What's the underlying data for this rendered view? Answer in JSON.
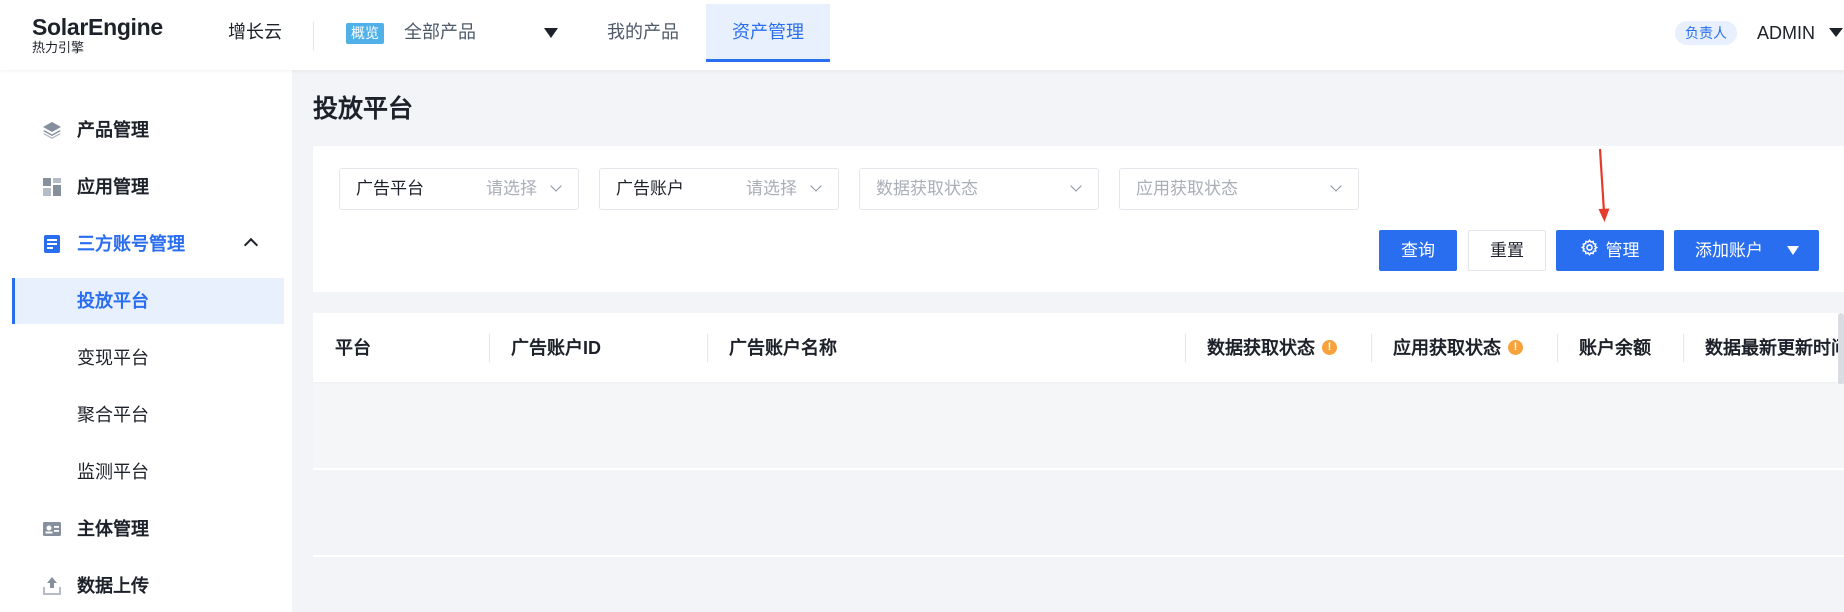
{
  "header": {
    "logo_main": "SolarEngine",
    "logo_sub": "热力引擎",
    "nav_growth": "增长云",
    "overview_badge": "概览",
    "all_products": "全部产品",
    "my_products": "我的产品",
    "asset_management": "资产管理",
    "owner_badge": "负责人",
    "user_name": "ADMIN"
  },
  "sidebar": {
    "items": [
      {
        "label": "产品管理",
        "icon": "layers-icon"
      },
      {
        "label": "应用管理",
        "icon": "apps-grid-icon"
      },
      {
        "label": "三方账号管理",
        "icon": "account-book-icon",
        "expanded": true
      },
      {
        "label": "投放平台",
        "active": true
      },
      {
        "label": "变现平台"
      },
      {
        "label": "聚合平台"
      },
      {
        "label": "监测平台"
      },
      {
        "label": "主体管理",
        "icon": "id-card-icon"
      },
      {
        "label": "数据上传",
        "icon": "upload-icon"
      }
    ]
  },
  "main": {
    "page_title": "投放平台",
    "filters": [
      {
        "label": "广告平台",
        "placeholder": "请选择"
      },
      {
        "label": "广告账户",
        "placeholder": "请选择"
      },
      {
        "placeholder": "数据获取状态"
      },
      {
        "placeholder": "应用获取状态"
      }
    ],
    "buttons": {
      "query": "查询",
      "reset": "重置",
      "manage": "管理",
      "add_account": "添加账户"
    },
    "table": {
      "columns": [
        "平台",
        "广告账户ID",
        "广告账户名称",
        "数据获取状态",
        "应用获取状态",
        "账户余额",
        "数据最新更新时间"
      ],
      "warn_mark": "!"
    }
  },
  "colors": {
    "primary": "#2a6ef0",
    "warning": "#f7a23b",
    "annotation": "#e53b2c",
    "badge": "#50b0e8"
  }
}
